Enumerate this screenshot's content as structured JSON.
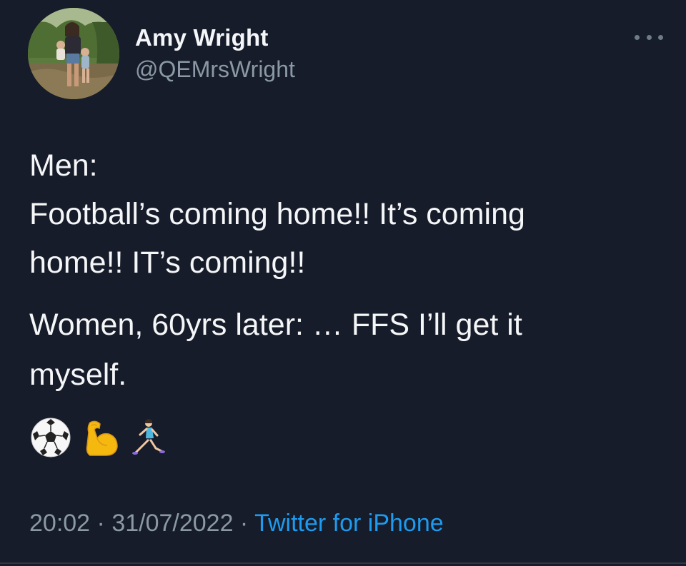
{
  "tweet": {
    "author": {
      "display_name": "Amy Wright",
      "handle": "@QEMrsWright"
    },
    "text_lines": [
      "Men:",
      "Football’s coming home!! It’s coming",
      "home!! IT’s coming!!",
      "Women, 60yrs later: … FFS I’ll get it",
      "myself."
    ],
    "emojis": [
      "soccer-ball",
      "flexed-biceps",
      "woman-running"
    ],
    "meta": {
      "time": "20:02",
      "separator1": " · ",
      "date": "31/07/2022",
      "separator2": " · ",
      "source": "Twitter for iPhone"
    },
    "menu_icon": "more-horizontal-icon"
  },
  "colors": {
    "background": "#161c29",
    "text": "#f5f6f8",
    "secondary_text": "#8b98a5",
    "link": "#1d9bf0"
  }
}
